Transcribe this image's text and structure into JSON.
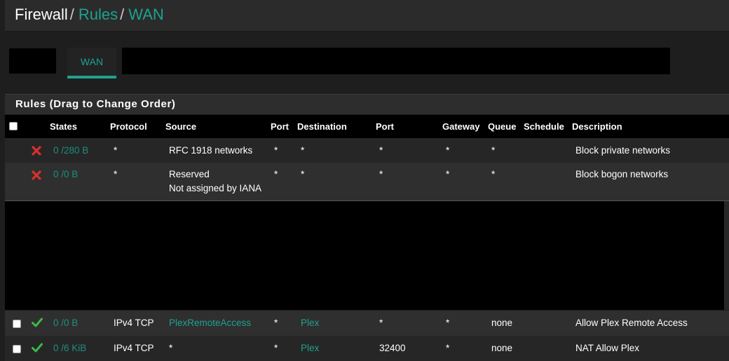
{
  "breadcrumb": {
    "root": "Firewall",
    "sep": "/",
    "rules": "Rules",
    "current": "WAN"
  },
  "tabs": [
    {
      "label": "WAN",
      "active": true
    }
  ],
  "panel": {
    "title": "Rules (Drag to Change Order)"
  },
  "table": {
    "columns": [
      "States",
      "Protocol",
      "Source",
      "Port",
      "Destination",
      "Port",
      "Gateway",
      "Queue",
      "Schedule",
      "Description"
    ],
    "rows": [
      {
        "status": "block",
        "states": "0 /280 B",
        "protocol": "*",
        "source": "RFC 1918 networks",
        "source2": "",
        "src_port": "*",
        "destination": "*",
        "dst_port": "*",
        "gateway": "*",
        "queue": "*",
        "schedule": "",
        "description": "Block private networks"
      },
      {
        "status": "block",
        "states": "0 /0 B",
        "protocol": "*",
        "source": "Reserved",
        "source2": "Not assigned by IANA",
        "src_port": "*",
        "destination": "*",
        "dst_port": "*",
        "gateway": "*",
        "queue": "*",
        "schedule": "",
        "description": "Block bogon networks"
      },
      {
        "status": "pass",
        "states": "0 /0 B",
        "protocol": "IPv4 TCP",
        "source": "PlexRemoteAccess",
        "source2": "",
        "src_port": "*",
        "destination": "Plex",
        "dst_port": "*",
        "gateway": "*",
        "queue": "none",
        "schedule": "",
        "description": "Allow Plex Remote Access"
      },
      {
        "status": "pass",
        "states": "0 /6 KiB",
        "protocol": "IPv4 TCP",
        "source": "*",
        "source2": "",
        "src_port": "*",
        "destination": "Plex",
        "dst_port": "32400",
        "gateway": "*",
        "queue": "none",
        "schedule": "",
        "description": "NAT Allow Plex"
      }
    ]
  },
  "colors": {
    "accent": "#1fa28f",
    "block": "#d9302c",
    "pass": "#3cb94a"
  }
}
